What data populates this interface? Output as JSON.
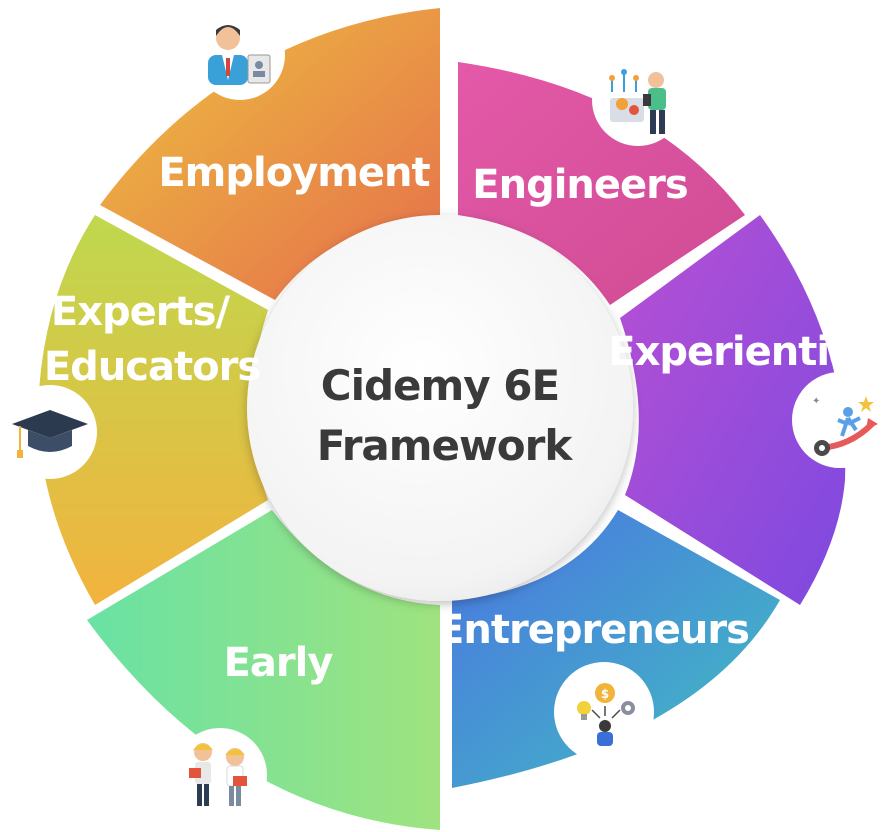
{
  "center": {
    "title_line1": "Cidemy 6E",
    "title_line2": "Framework"
  },
  "segments": [
    {
      "id": "employment",
      "label": "Employment",
      "color_start": "#eea93f",
      "color_end": "#e6744a",
      "icon": "businessman-icon"
    },
    {
      "id": "engineers",
      "label": "Engineers",
      "color_start": "#e357a5",
      "color_end": "#d04ea0",
      "icon": "engineer-icon"
    },
    {
      "id": "experiential",
      "label": "Experiential",
      "color_start": "#a34fd6",
      "color_end": "#7e4be0",
      "icon": "growth-icon"
    },
    {
      "id": "entrepreneurs",
      "label": "Entrepreneurs",
      "color_start": "#4a7fe0",
      "color_end": "#3fb6c4",
      "icon": "entrepreneur-icon"
    },
    {
      "id": "early",
      "label": "Early",
      "color_start": "#6fe29a",
      "color_end": "#8fe58a",
      "icon": "children-icon"
    },
    {
      "id": "experts",
      "label_line1": "Experts/",
      "label_line2": "Educators",
      "color_start": "#c9d94a",
      "color_end": "#e8bf42",
      "icon": "graduation-cap-icon"
    }
  ]
}
